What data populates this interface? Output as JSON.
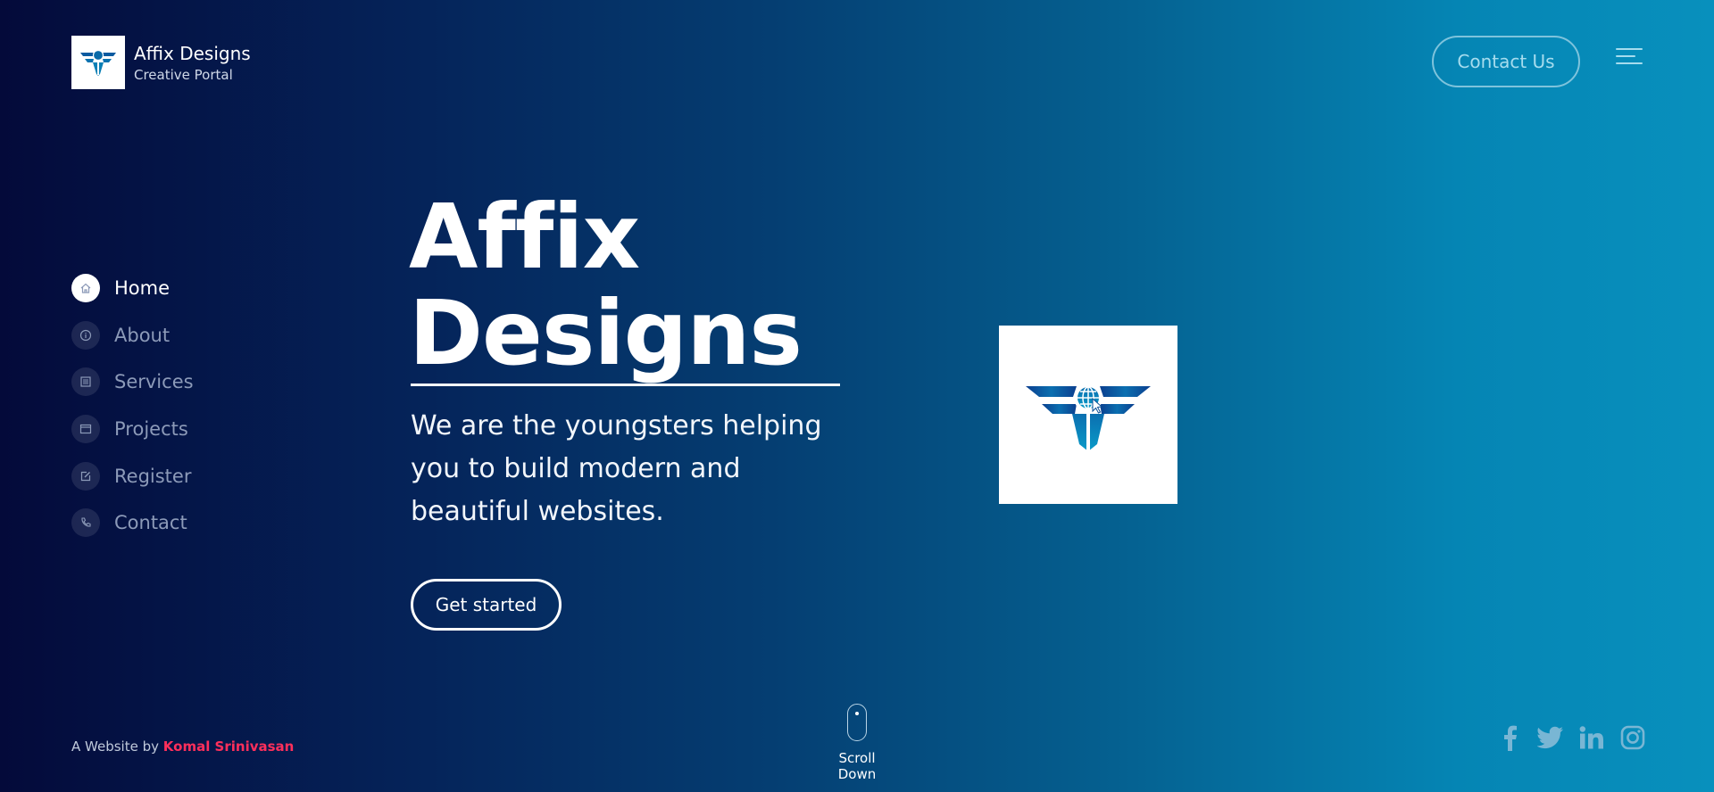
{
  "brand": {
    "name": "Affix Designs",
    "tagline": "Creative Portal",
    "logo_icon": "winged-globe-logo"
  },
  "header": {
    "contact_label": "Contact Us",
    "menu_icon": "hamburger-menu-icon"
  },
  "nav": {
    "items": [
      {
        "label": "Home",
        "icon": "home-icon",
        "active": true
      },
      {
        "label": "About",
        "icon": "info-icon",
        "active": false
      },
      {
        "label": "Services",
        "icon": "list-icon",
        "active": false
      },
      {
        "label": "Projects",
        "icon": "window-icon",
        "active": false
      },
      {
        "label": "Register",
        "icon": "edit-icon",
        "active": false
      },
      {
        "label": "Contact",
        "icon": "phone-icon",
        "active": false
      }
    ]
  },
  "hero": {
    "title_line1": "Affix",
    "title_line2": "Designs",
    "subtitle": "We are the youngsters helping you to build modern and beautiful websites.",
    "cta_label": "Get started"
  },
  "footer": {
    "credit_prefix": "A Website by",
    "credit_author": "Komal Srinivasan",
    "scroll_label": "Scroll Down",
    "social": [
      "facebook-icon",
      "twitter-icon",
      "linkedin-icon",
      "instagram-icon"
    ]
  },
  "colors": {
    "gradient_start": "#040a3a",
    "gradient_end": "#0890bd",
    "accent_pink": "#ff2f5b",
    "logo_blue": "#0b78b0"
  }
}
